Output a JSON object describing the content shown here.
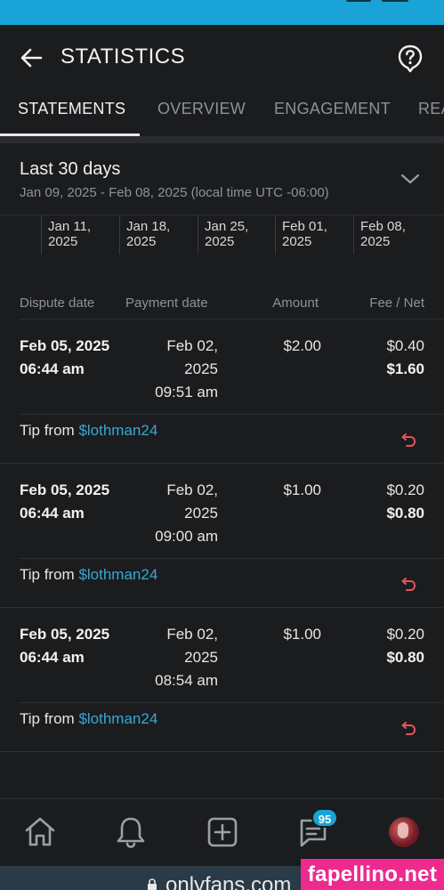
{
  "app": {
    "title": "STATISTICS",
    "url": "onlyfans.com"
  },
  "tabs": [
    {
      "label": "STATEMENTS",
      "active": true
    },
    {
      "label": "OVERVIEW",
      "active": false
    },
    {
      "label": "ENGAGEMENT",
      "active": false
    },
    {
      "label": "REA",
      "active": false
    }
  ],
  "range": {
    "label": "Last 30 days",
    "dates": "Jan 09, 2025 - Feb 08, 2025 (local time UTC -06:00)"
  },
  "timeline": [
    "Jan 11,\n2025",
    "Jan 18,\n2025",
    "Jan 25,\n2025",
    "Feb 01,\n2025",
    "Feb 08,\n2025"
  ],
  "table": {
    "headers": {
      "dispute": "Dispute date",
      "payment": "Payment date",
      "amount": "Amount",
      "fee_net": "Fee / Net"
    },
    "rows": [
      {
        "dispute_date": "Feb 05, 2025",
        "dispute_time": "06:44 am",
        "payment_date": "Feb 02, 2025",
        "payment_time": "09:51 am",
        "amount": "$2.00",
        "fee": "$0.40",
        "net": "$1.60",
        "tip_prefix": "Tip from ",
        "tip_user": "$lothman24"
      },
      {
        "dispute_date": "Feb 05, 2025",
        "dispute_time": "06:44 am",
        "payment_date": "Feb 02, 2025",
        "payment_time": "09:00 am",
        "amount": "$1.00",
        "fee": "$0.20",
        "net": "$0.80",
        "tip_prefix": "Tip from ",
        "tip_user": "$lothman24"
      },
      {
        "dispute_date": "Feb 05, 2025",
        "dispute_time": "06:44 am",
        "payment_date": "Feb 02, 2025",
        "payment_time": "08:54 am",
        "amount": "$1.00",
        "fee": "$0.20",
        "net": "$0.80",
        "tip_prefix": "Tip from ",
        "tip_user": "$lothman24"
      }
    ]
  },
  "nav": {
    "messages_badge": "95"
  },
  "watermark": "fapellino.net",
  "colors": {
    "accent": "#1aa3d6",
    "link": "#36a7d8",
    "refund_icon": "#e0575b",
    "watermark_bg": "#ee2a8f"
  }
}
